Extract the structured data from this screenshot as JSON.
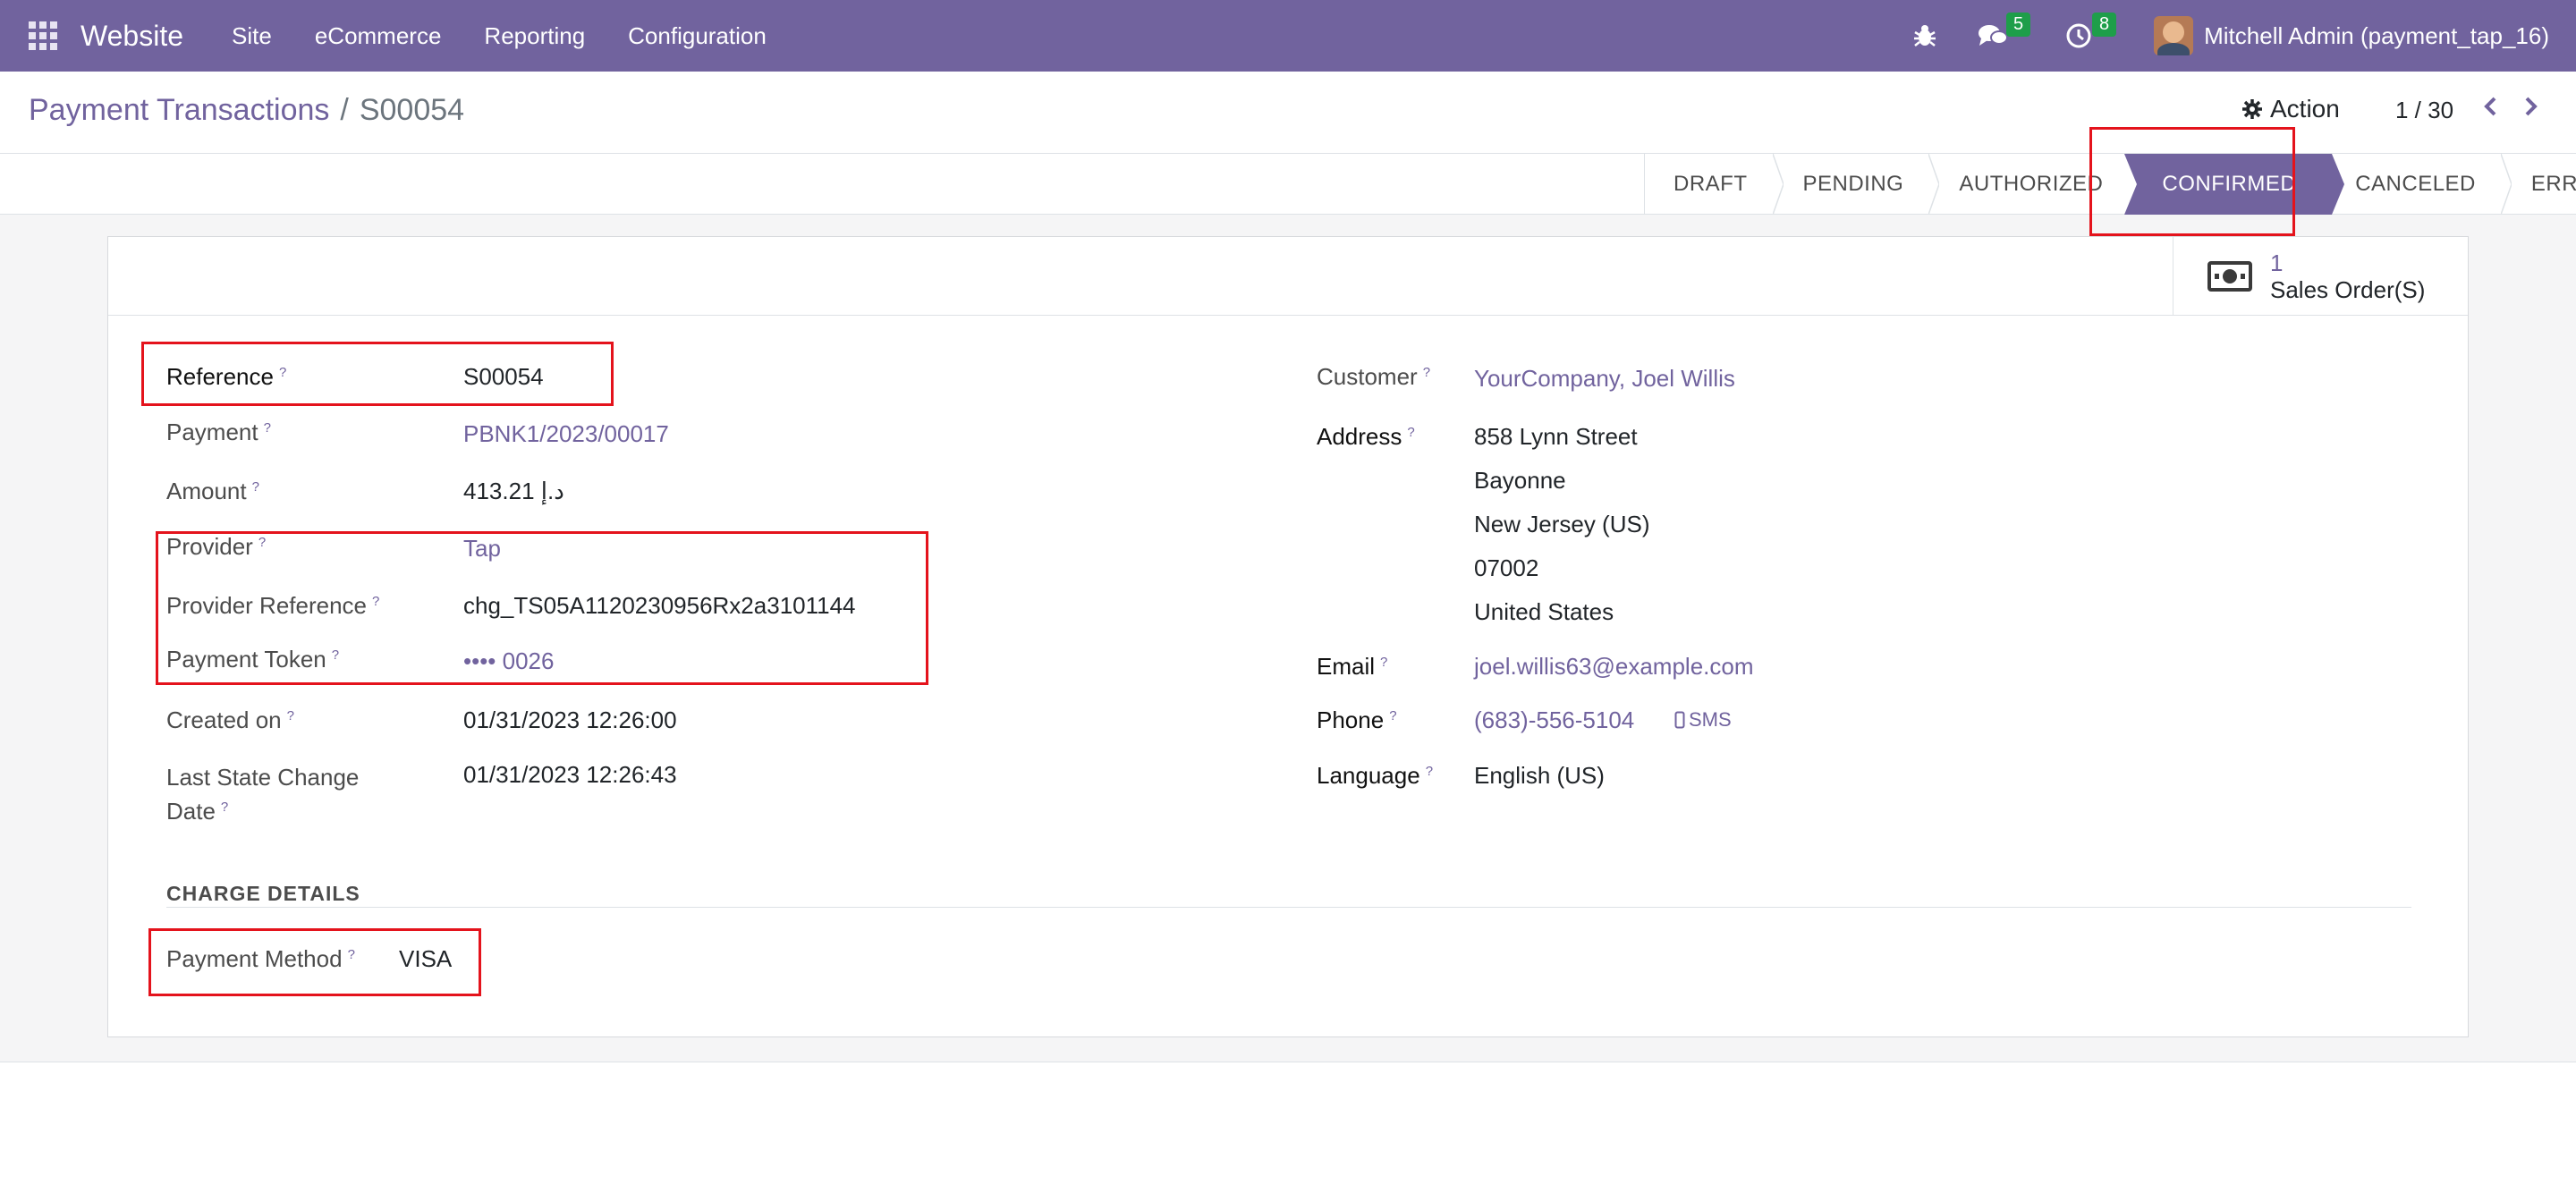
{
  "navbar": {
    "brand": "Website",
    "menu": [
      "Site",
      "eCommerce",
      "Reporting",
      "Configuration"
    ],
    "messages_count": "5",
    "activities_count": "8",
    "user": "Mitchell Admin (payment_tap_16)"
  },
  "breadcrumb": {
    "parent": "Payment Transactions",
    "separator": "/",
    "current": "S00054"
  },
  "control": {
    "action_label": "Action",
    "pager": "1 / 30"
  },
  "statusbar": {
    "steps": [
      "DRAFT",
      "PENDING",
      "AUTHORIZED",
      "CONFIRMED",
      "CANCELED",
      "ERROR"
    ],
    "active": "CONFIRMED"
  },
  "smart_button": {
    "count": "1",
    "label": "Sales Order(S)"
  },
  "left_fields": {
    "reference": {
      "label": "Reference",
      "value": "S00054"
    },
    "payment": {
      "label": "Payment",
      "value": "PBNK1/2023/00017"
    },
    "amount": {
      "label": "Amount",
      "value": "413.21 د.إ"
    },
    "provider": {
      "label": "Provider",
      "value": "Tap"
    },
    "provider_reference": {
      "label": "Provider Reference",
      "value": "chg_TS05A1120230956Rx2a3101144"
    },
    "payment_token": {
      "label": "Payment Token",
      "value": "•••• 0026"
    },
    "created_on": {
      "label": "Created on",
      "value": "01/31/2023 12:26:00"
    },
    "last_state_change_1": "Last State Change",
    "last_state_change_2": "Date",
    "last_state_change_value": "01/31/2023 12:26:43"
  },
  "right_fields": {
    "customer": {
      "label": "Customer",
      "value": "YourCompany, Joel Willis"
    },
    "address": {
      "label": "Address",
      "lines": [
        "858 Lynn Street",
        "Bayonne",
        "New Jersey (US)",
        "07002",
        "United States"
      ]
    },
    "email": {
      "label": "Email",
      "value": "joel.willis63@example.com"
    },
    "phone": {
      "label": "Phone",
      "value": "(683)-556-5104",
      "sms": "SMS"
    },
    "language": {
      "label": "Language",
      "value": "English (US)"
    }
  },
  "charge_details": {
    "title": "CHARGE DETAILS",
    "payment_method": {
      "label": "Payment Method",
      "value": "VISA"
    }
  },
  "colors": {
    "brand": "#71639e",
    "highlight": "#e4131c",
    "badge": "#1e9e4a"
  },
  "icons": [
    "apps-icon",
    "bug-icon",
    "chat-icon",
    "clock-icon",
    "gear-icon",
    "chevron-left-icon",
    "chevron-right-icon",
    "money-icon",
    "mobile-icon"
  ]
}
